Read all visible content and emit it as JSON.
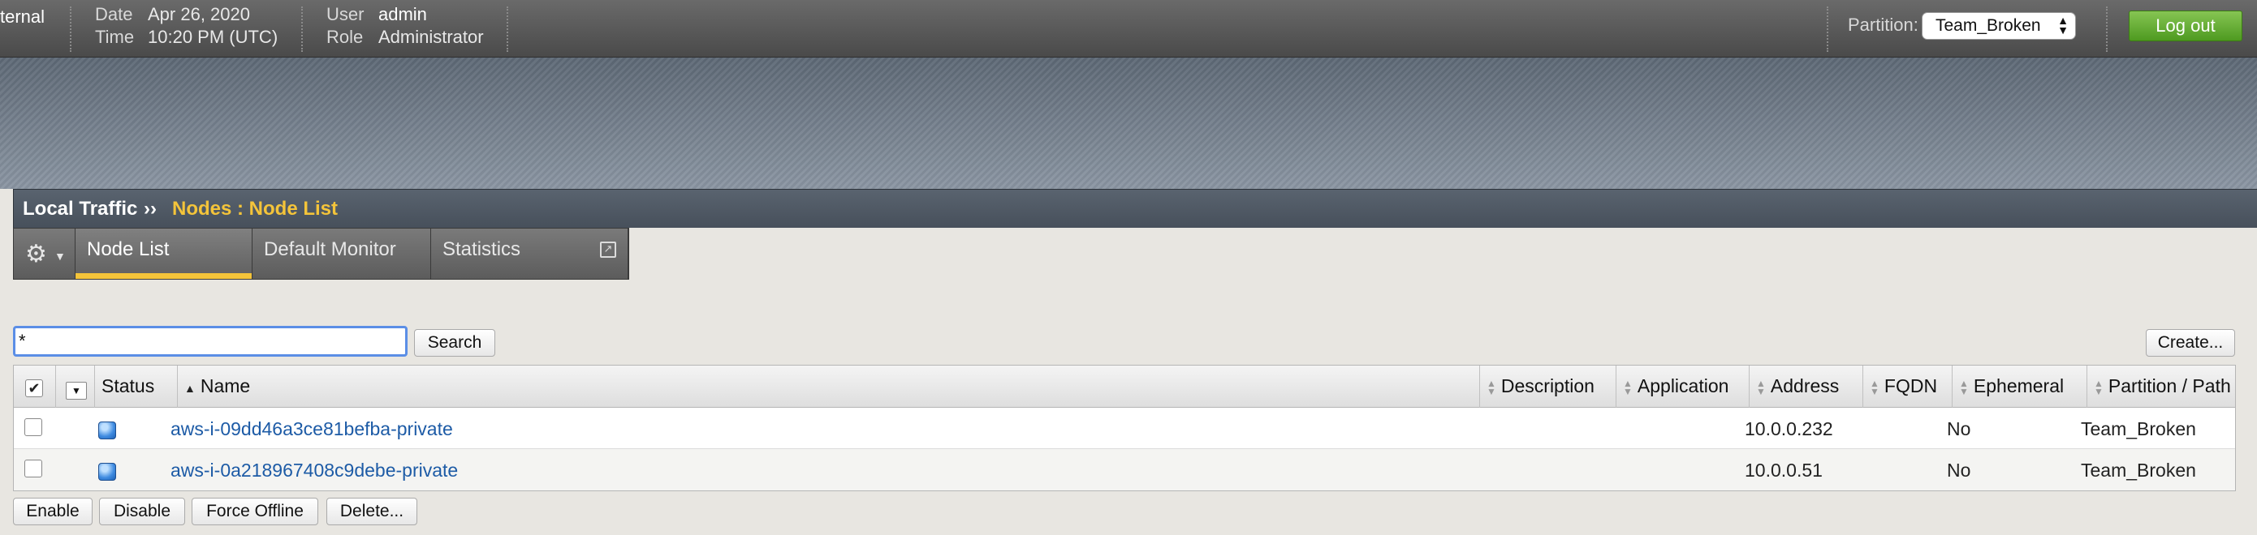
{
  "header": {
    "brand_fragment": "ternal",
    "date_label": "Date",
    "date_value": "Apr 26, 2020",
    "time_label": "Time",
    "time_value": "10:20 PM (UTC)",
    "user_label": "User",
    "user_value": "admin",
    "role_label": "Role",
    "role_value": "Administrator",
    "partition_label": "Partition:",
    "partition_value": "Team_Broken",
    "logout_label": "Log out"
  },
  "breadcrumb": {
    "root": "Local Traffic",
    "separator": "››",
    "current": "Nodes : Node List"
  },
  "tabs": [
    {
      "label": "Node List",
      "active": true
    },
    {
      "label": "Default Monitor",
      "active": false
    },
    {
      "label": "Statistics",
      "active": false
    }
  ],
  "search": {
    "value": "*",
    "button_label": "Search"
  },
  "create_label": "Create...",
  "table": {
    "columns": [
      "Status",
      "Name",
      "Description",
      "Application",
      "Address",
      "FQDN",
      "Ephemeral",
      "Partition / Path"
    ],
    "rows": [
      {
        "name": "aws-i-09dd46a3ce81befba-private",
        "description": "",
        "application": "",
        "address": "10.0.0.232",
        "fqdn": "",
        "ephemeral": "No",
        "partition": "Team_Broken"
      },
      {
        "name": "aws-i-0a218967408c9debe-private",
        "description": "",
        "application": "",
        "address": "10.0.0.51",
        "fqdn": "",
        "ephemeral": "No",
        "partition": "Team_Broken"
      }
    ]
  },
  "actions": [
    "Enable",
    "Disable",
    "Force Offline",
    "Delete..."
  ],
  "colors": {
    "accent_yellow": "#f4c43a",
    "logout_green": "#5fae2e",
    "link_blue": "#1d5ba6"
  }
}
